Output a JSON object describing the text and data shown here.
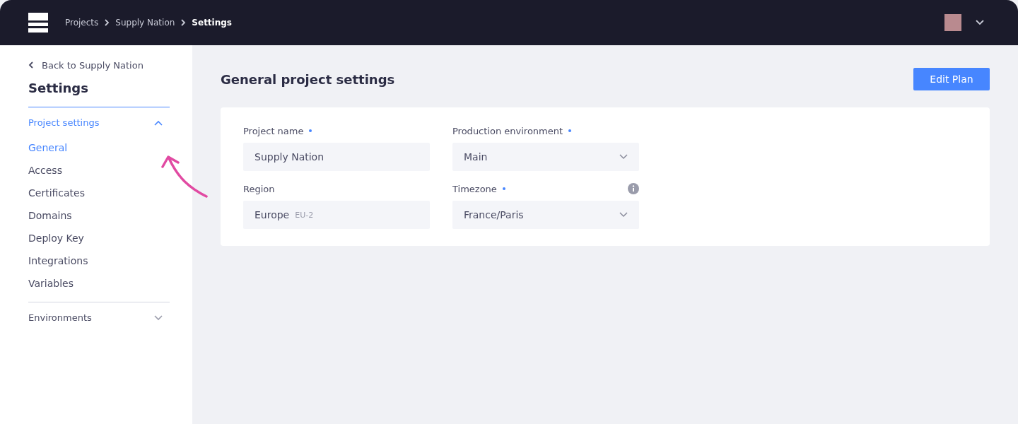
{
  "header": {
    "breadcrumbs": [
      {
        "label": "Projects",
        "current": false
      },
      {
        "label": "Supply Nation",
        "current": false
      },
      {
        "label": "Settings",
        "current": true
      }
    ]
  },
  "sidebar": {
    "back_link": "Back to Supply Nation",
    "title": "Settings",
    "sections": [
      {
        "label": "Project settings",
        "expanded": true,
        "items": [
          {
            "label": "General",
            "selected": true
          },
          {
            "label": "Access",
            "selected": false
          },
          {
            "label": "Certificates",
            "selected": false
          },
          {
            "label": "Domains",
            "selected": false
          },
          {
            "label": "Deploy Key",
            "selected": false
          },
          {
            "label": "Integrations",
            "selected": false
          },
          {
            "label": "Variables",
            "selected": false
          }
        ]
      },
      {
        "label": "Environments",
        "expanded": false
      }
    ]
  },
  "main": {
    "title": "General project settings",
    "edit_button": "Edit Plan",
    "fields": [
      {
        "kind": "text",
        "label": "Project name",
        "required": true,
        "info": false,
        "value": "Supply Nation"
      },
      {
        "kind": "select",
        "label": "Production environment",
        "required": true,
        "info": false,
        "value": "Main"
      },
      {
        "kind": "text",
        "label": "Region",
        "required": false,
        "info": false,
        "value": "Europe",
        "suffix": "EU-2"
      },
      {
        "kind": "select",
        "label": "Timezone",
        "required": true,
        "info": true,
        "value": "France/Paris"
      }
    ]
  }
}
